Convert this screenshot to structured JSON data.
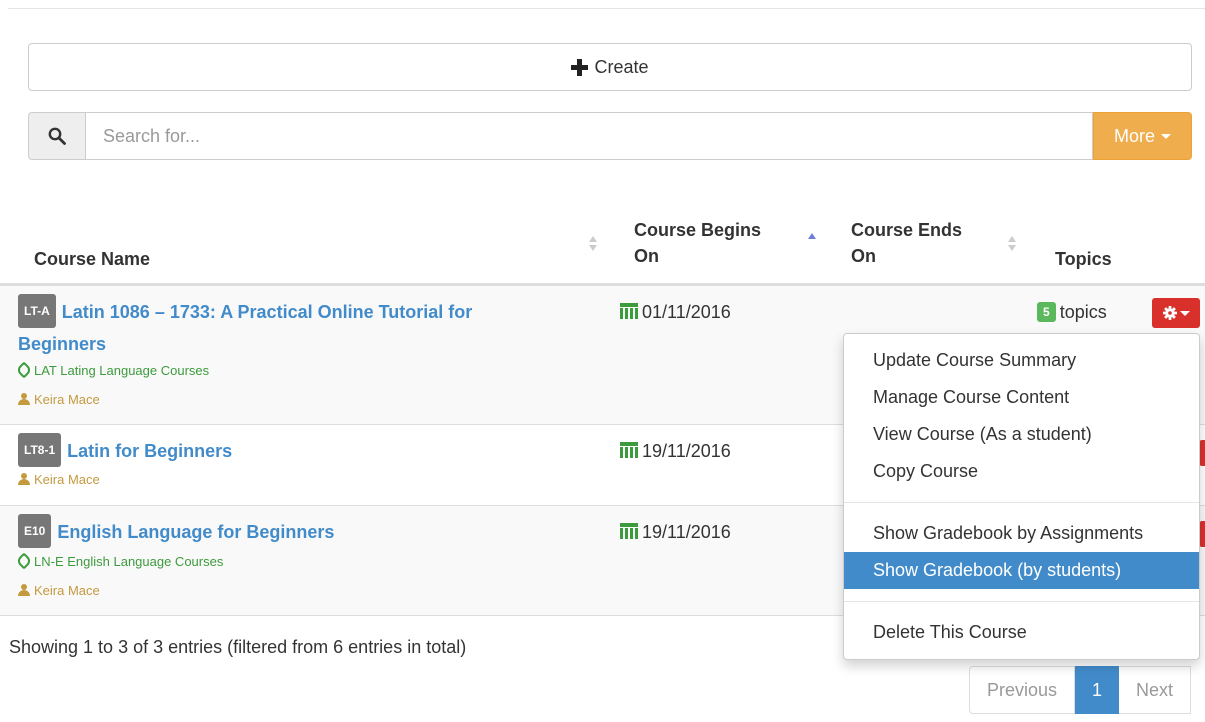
{
  "toolbar": {
    "create_label": "Create"
  },
  "search": {
    "placeholder": "Search for...",
    "more_label": "More"
  },
  "table": {
    "headers": {
      "course_name": "Course Name",
      "begins_line1": "Course Begins",
      "begins_line2": "On",
      "ends_line1": "Course Ends",
      "ends_line2": "On",
      "topics": "Topics"
    },
    "rows": [
      {
        "code": "LT-A",
        "title_line1": "Latin 1086 – 1733: A Practical Online Tutorial for",
        "title_line2": "Beginners",
        "category": "LAT Lating Language Courses",
        "author": "Keira Mace",
        "begins": "01/11/2016",
        "topics_count": "5",
        "topics_label": "topics"
      },
      {
        "code": "LT8-1",
        "title_line1": "Latin for Beginners",
        "author": "Keira Mace",
        "begins": "19/11/2016"
      },
      {
        "code": "E10",
        "title_line1": "English Language for Beginners",
        "category": "LN-E English Language Courses",
        "author": "Keira Mace",
        "begins": "19/11/2016"
      }
    ]
  },
  "dropdown": {
    "items": [
      "Update Course Summary",
      "Manage Course Content",
      "View Course (As a student)",
      "Copy Course",
      "Show Gradebook by Assignments",
      "Show Gradebook (by students)",
      "Delete This Course"
    ],
    "active_item": "Show Gradebook (by students)"
  },
  "footer": {
    "info": "Showing 1 to 3 of 3 entries (filtered from 6 entries in total)",
    "pagination": {
      "previous": "Previous",
      "current": "1",
      "next": "Next"
    }
  },
  "colors": {
    "primary": "#428bca",
    "warning": "#f0ad4e",
    "danger": "#d9302b",
    "success": "#5cb85c"
  }
}
